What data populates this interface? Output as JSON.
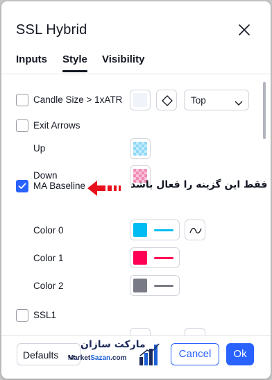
{
  "dialog": {
    "title": "SSL Hybrid"
  },
  "tabs": [
    {
      "label": "Inputs",
      "active": false
    },
    {
      "label": "Style",
      "active": true
    },
    {
      "label": "Visibility",
      "active": false
    }
  ],
  "rows": {
    "candle_size": {
      "label": "Candle Size > 1xATR",
      "checked": false,
      "position_value": "Top"
    },
    "exit_arrows": {
      "label": "Exit Arrows",
      "checked": false
    },
    "up": {
      "label": "Up",
      "color": "#8fd8f7"
    },
    "down": {
      "label": "Down",
      "color": "#f08ab4"
    },
    "ma_baseline": {
      "label": "MA Baseline",
      "checked": true
    },
    "color0": {
      "label": "Color 0",
      "color": "#00bcf2"
    },
    "color1": {
      "label": "Color 1",
      "color": "#ff0055"
    },
    "color2": {
      "label": "Color 2",
      "color": "#787b86"
    },
    "ssl1": {
      "label": "SSL1",
      "checked": false
    }
  },
  "annotation": {
    "text": "فقط این گزینه را فعال باشد",
    "arrow_color": "#e8101c"
  },
  "footer": {
    "defaults_label": "Defaults",
    "cancel_label": "Cancel",
    "ok_label": "Ok"
  },
  "watermark": {
    "fa_text": "مارکت سازان",
    "en_prefix": "Market",
    "en_accent": "Sazan",
    "en_suffix": ".com"
  },
  "colors": {
    "accent": "#2962ff",
    "text": "#131722",
    "border": "#d1d4dc"
  }
}
